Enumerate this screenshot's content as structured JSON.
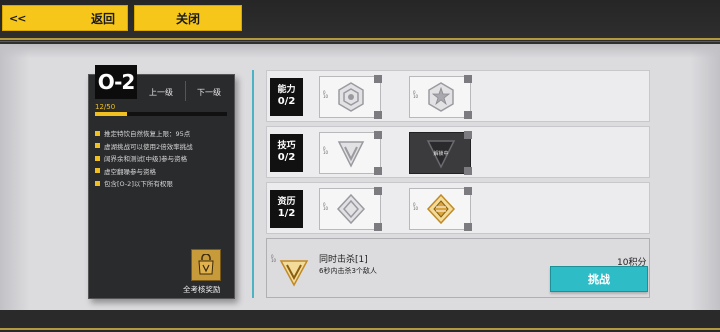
{
  "topbar": {
    "back_arrow": "<<",
    "back_label": "返回",
    "close_label": "关闭"
  },
  "stage": {
    "code": "O-2",
    "prev_label": "上一级",
    "next_label": "下一级",
    "progress_text": "12/50",
    "progress_fraction": 0.24,
    "rules": [
      "推定特饮自然恢复上限：95点",
      "虚湖挑战可以使用2倍效率挑战",
      "阔界余和测试[中级]参与资格",
      "虚空翻噪参与资格",
      "包含[O-2]以下所有权限"
    ],
    "reward_label": "全考核奖励"
  },
  "rows": [
    {
      "name": "能力",
      "count": "0/2",
      "badges": [
        {
          "dark": false,
          "text": ""
        },
        {
          "dark": false,
          "text": ""
        }
      ]
    },
    {
      "name": "技巧",
      "count": "0/2",
      "badges": [
        {
          "dark": false,
          "text": ""
        },
        {
          "dark": true,
          "text": "解锁中"
        }
      ]
    },
    {
      "name": "资历",
      "count": "1/2",
      "badges": [
        {
          "dark": false,
          "text": ""
        },
        {
          "dark": false,
          "text": ""
        }
      ]
    }
  ],
  "badge_tiny_text": "0\n10",
  "task": {
    "title": "同时击杀[1]",
    "description": "6秒内击杀3个敌人",
    "points": "10积分",
    "challenge_label": "挑战",
    "icon_tiny_text": "0\n10"
  },
  "colors": {
    "accent_yellow": "#f6c61b",
    "accent_cyan": "#2ebcc6",
    "gold_badge": "#d8a440"
  }
}
